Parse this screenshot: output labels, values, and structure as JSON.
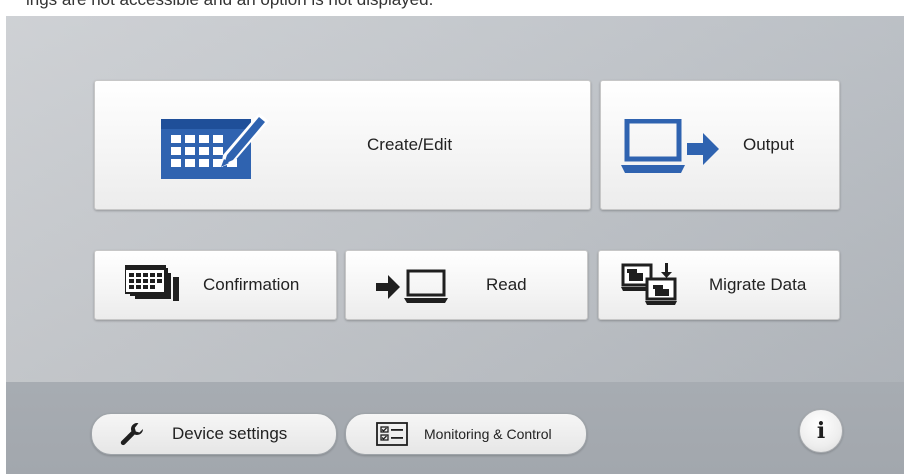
{
  "top_caption": "ings are not accessible and an option is not displayed.",
  "tiles": {
    "create_edit": "Create/Edit",
    "output": "Output",
    "confirmation": "Confirmation",
    "read": "Read",
    "migrate": "Migrate Data"
  },
  "bottom": {
    "device_settings": "Device settings",
    "monitoring": "Monitoring & Control",
    "info_glyph": "i"
  },
  "icons": {
    "create_edit": "calendar-edit-icon",
    "output": "laptop-output-icon",
    "confirmation": "stacked-calendars-icon",
    "read": "read-into-laptop-icon",
    "migrate": "migrate-data-icon",
    "device_settings": "wrench-icon",
    "monitoring": "checklist-icon",
    "info": "info-icon"
  },
  "colors": {
    "accent_blue": "#2f63b0",
    "icon_dark": "#1f1f1f"
  }
}
